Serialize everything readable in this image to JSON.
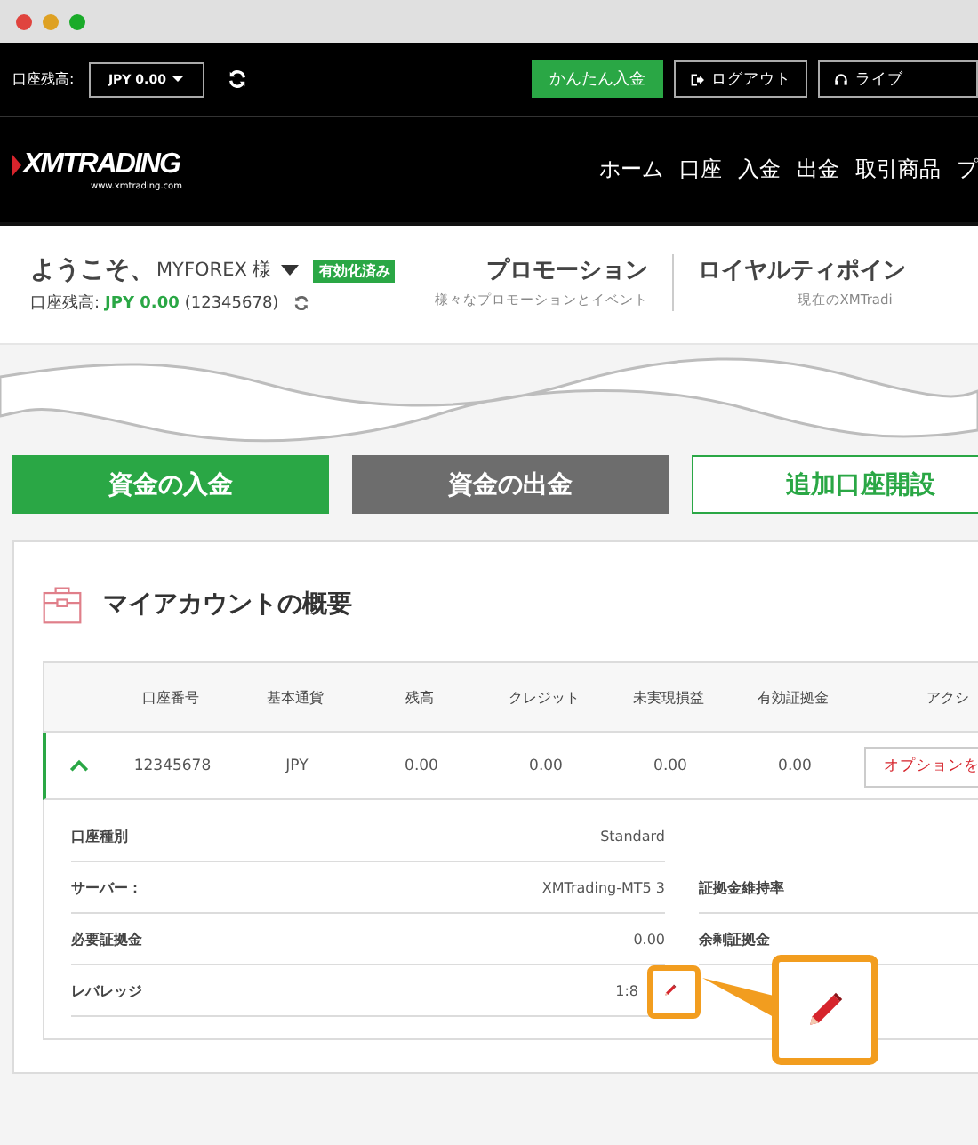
{
  "window": {
    "controls": [
      {
        "color": "#e0443e"
      },
      {
        "color": "#dea123"
      },
      {
        "color": "#1aab29"
      }
    ]
  },
  "top_bar": {
    "balance_label": "口座残高:",
    "balance_value": "JPY 0.00",
    "buttons": [
      {
        "label": "かんたん入金",
        "kind": "primary"
      },
      {
        "label": "ログアウト",
        "kind": "logout"
      },
      {
        "label": "ライブ",
        "kind": "chat"
      }
    ]
  },
  "nav": {
    "logo": "XMTRADING",
    "logo_url": "www.xmtrading.com",
    "items": [
      "ホーム",
      "口座",
      "入金",
      "出金",
      "取引商品",
      "プ"
    ]
  },
  "welcome": {
    "greeting": "ようこそ、",
    "user": "MYFOREX 様",
    "badge": "有効化済み",
    "balance_label": "口座残高:",
    "balance_value": "JPY 0.00",
    "account": "(12345678)"
  },
  "promos": [
    {
      "title": "プロモーション",
      "subtitle": "様々なプロモーションとイベント"
    },
    {
      "title": "ロイヤルティポイン",
      "subtitle": "現在のXMTradi"
    }
  ],
  "actions": [
    {
      "label": "資金の入金",
      "kind": "solid"
    },
    {
      "label": "資金の出金",
      "kind": "muted"
    },
    {
      "label": "追加口座開設",
      "kind": "outline"
    }
  ],
  "overview": {
    "title": "マイアカウントの概要",
    "columns": [
      "口座番号",
      "基本通貨",
      "残高",
      "クレジット",
      "未実現損益",
      "有効証拠金",
      "アクシ"
    ],
    "rows": [
      {
        "expanded": true,
        "cells": [
          "12345678",
          "JPY",
          "0.00",
          "0.00",
          "0.00",
          "0.00"
        ],
        "action": "オプションを"
      }
    ],
    "details": [
      {
        "label": "口座種別",
        "value": "Standard"
      },
      {
        "label": "サーバー：",
        "value": "XMTrading-MT5 3",
        "side_label": "証拠金維持率"
      },
      {
        "label": "必要証拠金",
        "value": "0.00",
        "side_label": "余剰証拠金"
      },
      {
        "label": "レバレッジ",
        "value": "1:8",
        "editable": true
      }
    ]
  }
}
